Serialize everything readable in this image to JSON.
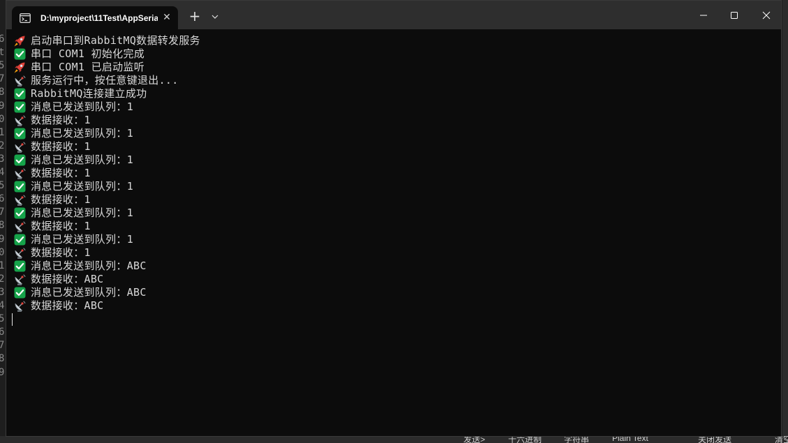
{
  "window": {
    "tab_title": "D:\\myproject\\11Test\\AppSeria",
    "new_tab_label": "+",
    "dropdown_label": "⌄"
  },
  "console_lines": [
    {
      "icon": "rocket-icon",
      "text": "启动串口到RabbitMQ数据转发服务"
    },
    {
      "icon": "checkmark-icon",
      "text": "串口 COM1 初始化完成"
    },
    {
      "icon": "rocket-icon",
      "text": "串口 COM1 已启动监听"
    },
    {
      "icon": "satellite-antenna-icon",
      "text": "服务运行中，按任意键退出..."
    },
    {
      "icon": "checkmark-icon",
      "text": "RabbitMQ连接建立成功"
    },
    {
      "icon": "checkmark-icon",
      "text": "消息已发送到队列：1"
    },
    {
      "icon": "satellite-antenna-icon",
      "text": "数据接收：1"
    },
    {
      "icon": "checkmark-icon",
      "text": "消息已发送到队列：1"
    },
    {
      "icon": "satellite-antenna-icon",
      "text": "数据接收：1"
    },
    {
      "icon": "checkmark-icon",
      "text": "消息已发送到队列：1"
    },
    {
      "icon": "satellite-antenna-icon",
      "text": "数据接收：1"
    },
    {
      "icon": "checkmark-icon",
      "text": "消息已发送到队列：1"
    },
    {
      "icon": "satellite-antenna-icon",
      "text": "数据接收：1"
    },
    {
      "icon": "checkmark-icon",
      "text": "消息已发送到队列：1"
    },
    {
      "icon": "satellite-antenna-icon",
      "text": "数据接收：1"
    },
    {
      "icon": "checkmark-icon",
      "text": "消息已发送到队列：1"
    },
    {
      "icon": "satellite-antenna-icon",
      "text": "数据接收：1"
    },
    {
      "icon": "checkmark-icon",
      "text": "消息已发送到队列：ABC"
    },
    {
      "icon": "satellite-antenna-icon",
      "text": "数据接收：ABC"
    },
    {
      "icon": "checkmark-icon",
      "text": "消息已发送到队列：ABC"
    },
    {
      "icon": "satellite-antenna-icon",
      "text": "数据接收：ABC"
    }
  ],
  "background_app": {
    "gutter_digits": [
      "6",
      "t",
      "5",
      "7",
      "8",
      "9",
      "0",
      "1",
      "2",
      "3",
      "4",
      "5",
      "6",
      "7",
      "8",
      "9",
      "0",
      "1",
      "2",
      "3",
      "4",
      "5",
      "6",
      "7",
      "8",
      "9"
    ],
    "status_fragments": [
      "发送>",
      "十六进制",
      "字符串",
      "Plain Text",
      "关闭发送",
      "清空"
    ]
  },
  "colors": {
    "terminal_bg": "#0c0c0c",
    "titlebar_bg": "#2e2e2e",
    "text": "#d8d8d8",
    "check_green": "#16a34a",
    "rocket_red": "#e0433b"
  }
}
